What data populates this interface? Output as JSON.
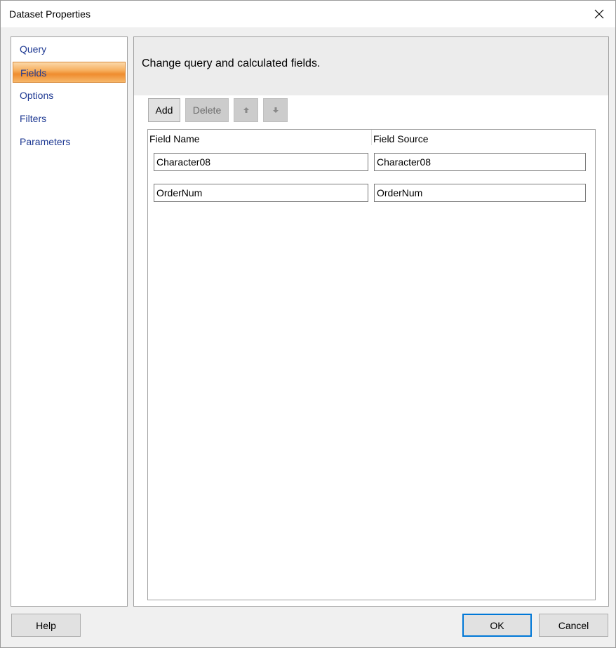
{
  "window": {
    "title": "Dataset Properties"
  },
  "nav": {
    "items": [
      {
        "label": "Query",
        "selected": false
      },
      {
        "label": "Fields",
        "selected": true
      },
      {
        "label": "Options",
        "selected": false
      },
      {
        "label": "Filters",
        "selected": false
      },
      {
        "label": "Parameters",
        "selected": false
      }
    ]
  },
  "content": {
    "header": "Change query and calculated fields.",
    "toolbar": {
      "add_label": "Add",
      "delete_label": "Delete",
      "move_up_icon": "arrow-up-icon",
      "move_down_icon": "arrow-down-icon"
    },
    "grid": {
      "columns": [
        "Field Name",
        "Field Source"
      ],
      "rows": [
        {
          "field_name": "Character08",
          "field_source": "Character08"
        },
        {
          "field_name": "OrderNum",
          "field_source": "OrderNum"
        }
      ]
    }
  },
  "footer": {
    "help_label": "Help",
    "ok_label": "OK",
    "cancel_label": "Cancel"
  },
  "colors": {
    "selected_nav": "#f7a84f",
    "nav_text": "#1f3a93",
    "default_button_border": "#0078d7"
  }
}
